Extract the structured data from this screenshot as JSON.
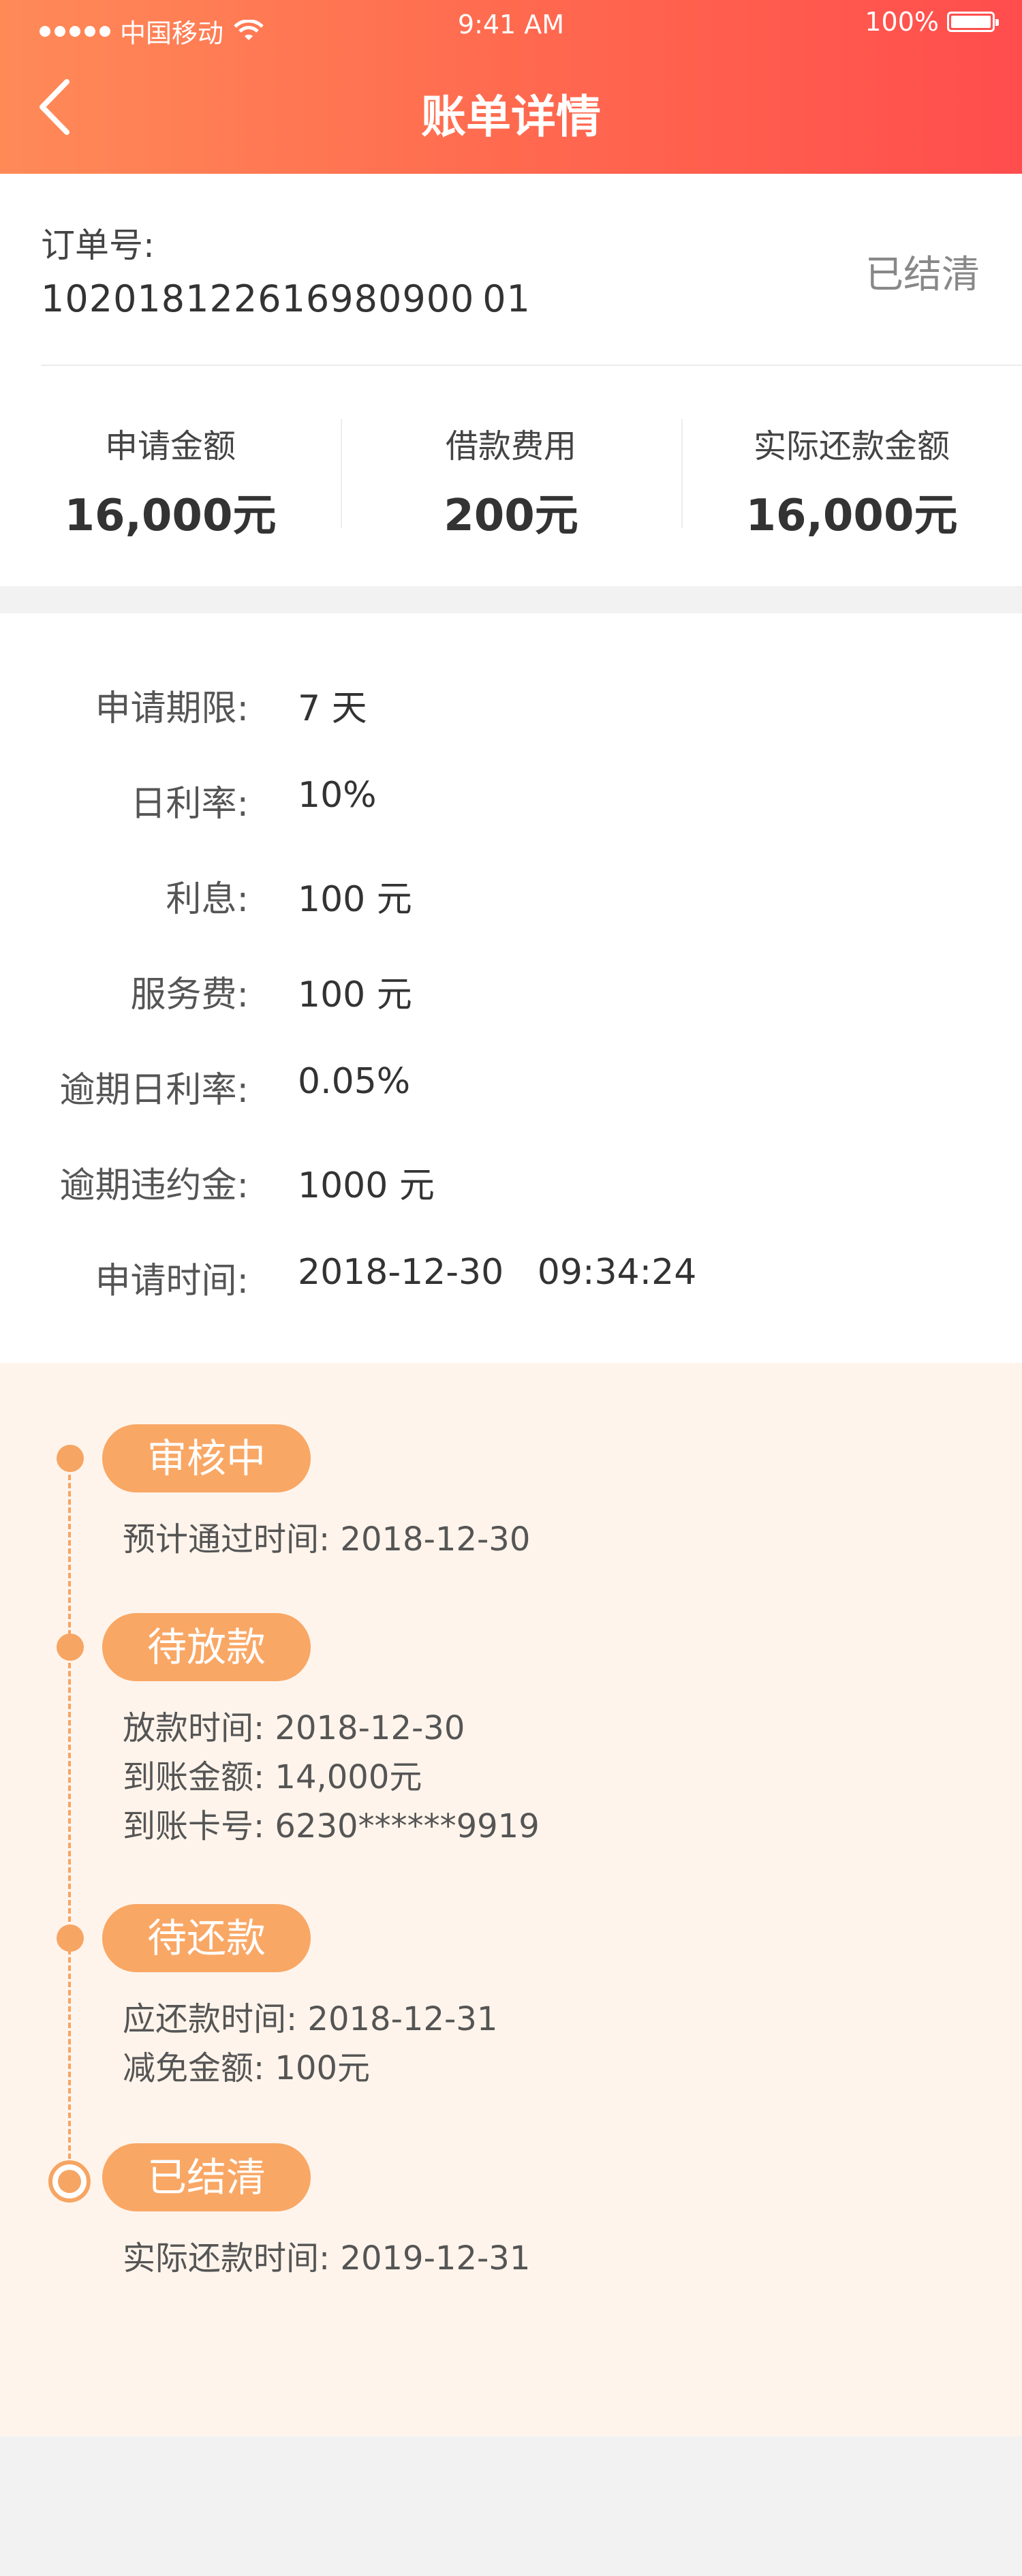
{
  "status_bar": {
    "carrier": "中国移动",
    "time": "9:41 AM",
    "battery": "100%"
  },
  "nav": {
    "title": "账单详情"
  },
  "order": {
    "label": "订单号:",
    "number": "102018122616980900 01",
    "status": "已结清"
  },
  "summary": [
    {
      "label": "申请金额",
      "value": "16,000元"
    },
    {
      "label": "借款费用",
      "value": "200元"
    },
    {
      "label": "实际还款金额",
      "value": "16,000元"
    }
  ],
  "details": [
    {
      "label": "申请期限:",
      "value": "7 天"
    },
    {
      "label": "日利率:",
      "value": "10%"
    },
    {
      "label": "利息:",
      "value": "100 元"
    },
    {
      "label": "服务费:",
      "value": "100 元"
    },
    {
      "label": "逾期日利率:",
      "value": "0.05%"
    },
    {
      "label": "逾期违约金:",
      "value": "1000 元"
    },
    {
      "label": "申请时间:",
      "value": "2018-12-30   09:34:24"
    }
  ],
  "timeline": [
    {
      "badge": "审核中",
      "lines": [
        "预计通过时间: 2018-12-30"
      ]
    },
    {
      "badge": "待放款",
      "lines": [
        "放款时间: 2018-12-30",
        "到账金额: 14,000元",
        "到账卡号: 6230******9919"
      ]
    },
    {
      "badge": "待还款",
      "lines": [
        "应还款时间: 2018-12-31",
        "减免金额: 100元"
      ]
    },
    {
      "badge": "已结清",
      "lines": [
        "实际还款时间: 2019-12-31"
      ]
    }
  ],
  "colors": {
    "header_start": "#ff8a58",
    "header_end": "#ff4d4d",
    "accent": "#f9a765",
    "timeline_bg": "#fff4eb"
  }
}
